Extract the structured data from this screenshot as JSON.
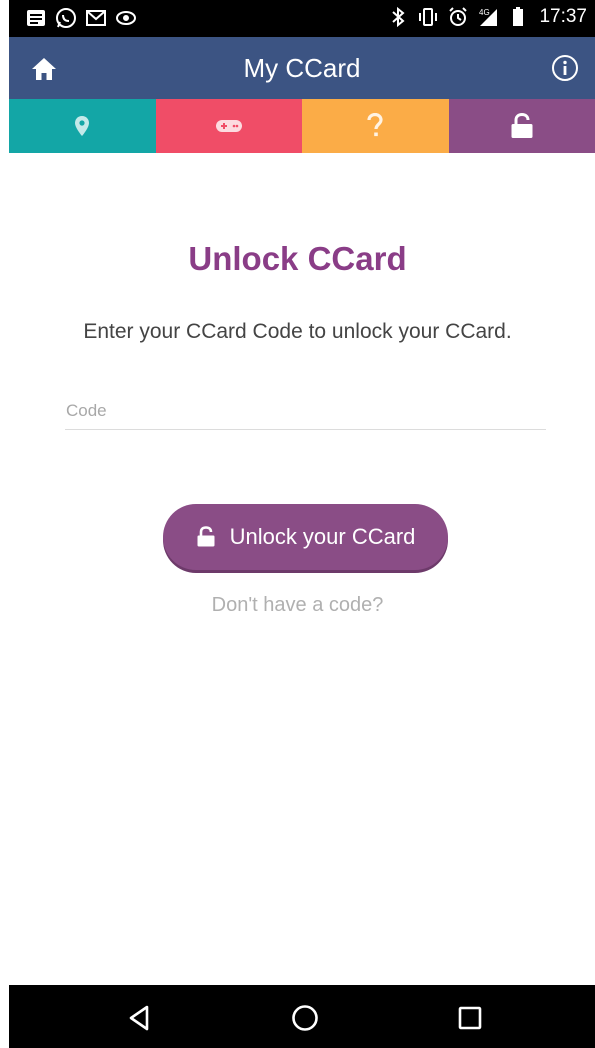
{
  "status_bar": {
    "time": "17:37",
    "left_icons": [
      "notes-icon",
      "whatsapp-icon",
      "gmail-icon",
      "browser-icon"
    ],
    "right_icons": [
      "bluetooth-icon",
      "vibrate-icon",
      "alarm-icon",
      "signal-4g-icon",
      "battery-icon"
    ]
  },
  "app_bar": {
    "title": "My CCard",
    "left_icon": "home-icon",
    "right_icon": "info-icon"
  },
  "tabs": [
    {
      "name": "map",
      "icon": "map-pin-icon",
      "color": "#13a6a6"
    },
    {
      "name": "games",
      "icon": "gamepad-icon",
      "color": "#f04d67"
    },
    {
      "name": "help",
      "icon": "question-icon",
      "color": "#fbac47"
    },
    {
      "name": "unlock",
      "icon": "unlock-icon",
      "color": "#8a4d86"
    }
  ],
  "content": {
    "heading": "Unlock CCard",
    "subtitle": "Enter your CCard Code to unlock your CCard.",
    "code_placeholder": "Code",
    "unlock_button_label": "Unlock your CCard",
    "no_code_link": "Don't have a code?"
  },
  "colors": {
    "app_bar": "#3c5483",
    "accent": "#8a3d87",
    "button": "#8a4d86"
  },
  "nav_bar": {
    "icons": [
      "back-icon",
      "home-circle-icon",
      "recents-icon"
    ]
  }
}
